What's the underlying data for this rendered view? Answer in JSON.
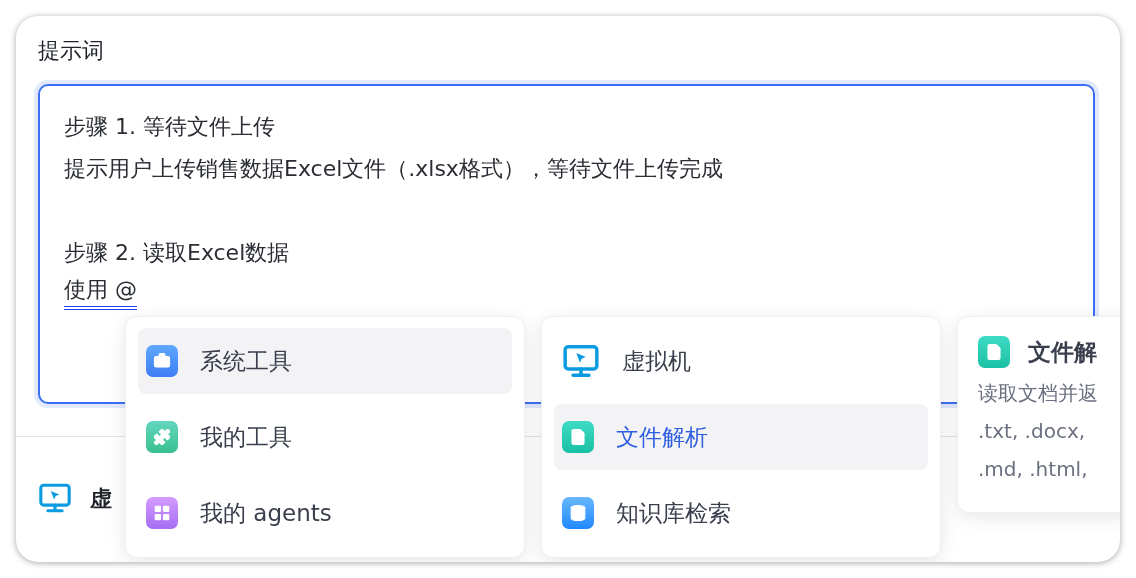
{
  "section_title": "提示词",
  "prompt": {
    "paragraphs": [
      [
        "步骤 1. 等待文件上传",
        "提示用户上传销售数据Excel文件（.xlsx格式），等待文件上传完成"
      ],
      [
        "步骤 2. 读取Excel数据"
      ]
    ],
    "mention_line": "使用 @"
  },
  "bottom_bar": {
    "label": "虚"
  },
  "menus": [
    {
      "kind": "category",
      "items": [
        {
          "label": "系统工具",
          "selected": true
        },
        {
          "label": "我的工具",
          "selected": false
        },
        {
          "label": "我的 agents",
          "selected": false
        }
      ]
    },
    {
      "kind": "tool",
      "items": [
        {
          "label": "虚拟机",
          "selected": false
        },
        {
          "label": "文件解析",
          "selected": true
        },
        {
          "label": "知识库检索",
          "selected": false
        }
      ]
    }
  ],
  "detail": {
    "title": "文件解",
    "description": [
      "读取文档并返",
      ".txt, .docx,",
      ".md, .html,"
    ]
  }
}
